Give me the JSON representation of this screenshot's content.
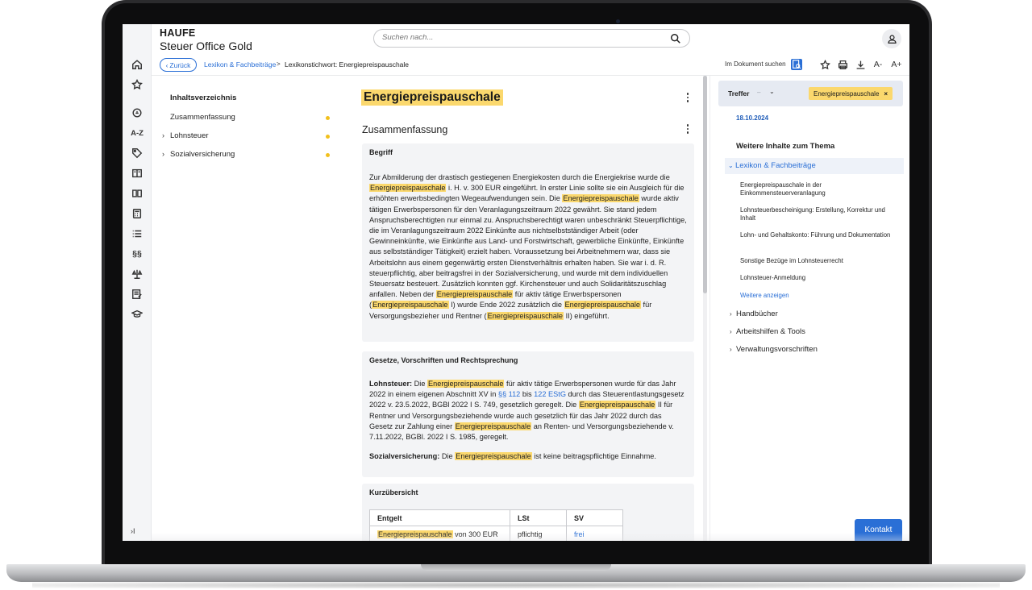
{
  "brand": {
    "company": "HAUFE",
    "product": "Steuer Office Gold"
  },
  "search": {
    "placeholder": "Suchen nach..."
  },
  "breadcrumb": {
    "back_label": "Zurück",
    "items": [
      "Lexikon & Fachbeiträge",
      "Lexikonstichwort: Energiepreispauschale"
    ],
    "separator": ">"
  },
  "doc_tools": {
    "search_in_doc": "Im Dokument suchen",
    "font_smaller": "A-",
    "font_larger": "A+"
  },
  "toc": {
    "title": "Inhaltsverzeichnis",
    "items": [
      {
        "label": "Zusammenfassung",
        "expandable": false
      },
      {
        "label": "Lohnsteuer",
        "expandable": true
      },
      {
        "label": "Sozialversicherung",
        "expandable": true
      }
    ]
  },
  "document": {
    "title": "Energiepreispauschale",
    "section_heading": "Zusammenfassung",
    "begriff": {
      "title": "Begriff",
      "p1": "Zur Abmilderung der drastisch gestiegenen Energiekosten durch die Energiekrise wurde die",
      "hl": "Energiepreispauschale",
      "p2": " i. H. v. 300 EUR eingeführt. In erster Linie sollte sie ein Ausgleich für die erhöhten erwerbsbedingten Wegeaufwendungen sein. Die ",
      "p3": " wurde aktiv tätigen Erwerbspersonen für den Veranlagungszeitraum 2022 gewährt. Sie stand jedem Anspruchsberechtigten nur einmal zu. Anspruchsberechtigt waren unbeschränkt Steuerpflichtige, die im Veranlagungszeitraum 2022 Einkünfte aus nichtselbstständiger Arbeit (oder Gewinneinkünfte, wie Einkünfte aus Land- und Forstwirtschaft, gewerbliche Einkünfte, Einkünfte aus selbstständiger Tätigkeit) erzielt haben. Voraussetzung bei Arbeitnehmern war, dass sie Arbeitslohn aus einem gegenwärtig ersten Dienstverhältnis erhalten haben. Sie war i. d. R. steuerpflichtig, aber beitragsfrei in der Sozialversicherung, und wurde mit dem individuellen Steuersatz besteuert. Zusätzlich konnten ggf. Kirchensteuer und auch Solidaritätszuschlag anfallen. Neben der ",
      "p4": " für aktiv tätige Erwerbspersonen (",
      "p5": " I) wurde Ende 2022 zusätzlich die ",
      "p6": " für Versorgungsbezieher und Rentner (",
      "p7": " II) eingeführt."
    },
    "gesetze": {
      "title": "Gesetze, Vorschriften und Rechtsprechung",
      "lst_label": "Lohnsteuer:",
      "lst_1": " Die ",
      "lst_2": " für aktiv tätige Erwerbspersonen wurde für das Jahr 2022 in einem eigenen Abschnitt XV in ",
      "link1": "§§ 112",
      "lst_3": " bis ",
      "link2": "122 EStG",
      "lst_4": " durch das Steuerentlastungsgesetz 2022 v. 23.5.2022, BGBl 2022 I S. 749, gesetzlich geregelt. Die ",
      "lst_5": " II für Rentner und Versorgungsbeziehende wurde auch gesetzlich für das Jahr 2022 durch das Gesetz zur Zahlung einer ",
      "lst_6": " an Renten- und Versorgungsbeziehende v. 7.11.2022, BGBl. 2022 I S. 1985, geregelt.",
      "sv_label": "Sozialversicherung:",
      "sv_1": " Die ",
      "sv_2": " ist keine beitragspflichtige Einnahme."
    },
    "kurz": {
      "title": "Kurzübersicht",
      "headers": [
        "Entgelt",
        "LSt",
        "SV"
      ],
      "row1": {
        "entgelt_suffix": " von 300 EUR",
        "lst": "pflichtig",
        "sv": "frei"
      }
    }
  },
  "right_panel": {
    "hits_label": "Treffer",
    "hits_dash": "–",
    "hit_tag": "Energiepreispauschale",
    "date": "18.10.2024",
    "more_title": "Weitere Inhalte zum Thema",
    "lexikon_label": "Lexikon & Fachbeiträge",
    "sub_items": [
      "Energiepreispauschale in der Einkommensteuerveranlagung",
      "Lohnsteuerbescheinigung: Erstellung, Korrektur und Inhalt",
      "Lohn- und Gehaltskonto: Führung und Dokumentation",
      "Sonstige Bezüge im Lohnsteuerrecht",
      "Lohnsteuer-Anmeldung"
    ],
    "more_link": "Weitere anzeigen",
    "groups": [
      "Handbücher",
      "Arbeitshilfen & Tools",
      "Verwaltungsvorschriften"
    ]
  },
  "contact": {
    "label": "Kontakt"
  },
  "rail": {
    "az_label": "A-Z",
    "paragraph_label": "§§",
    "expand_label": "›I"
  },
  "colors": {
    "accent": "#2a6fd6",
    "highlight": "#fbd86d",
    "dot": "#f2c01c"
  }
}
